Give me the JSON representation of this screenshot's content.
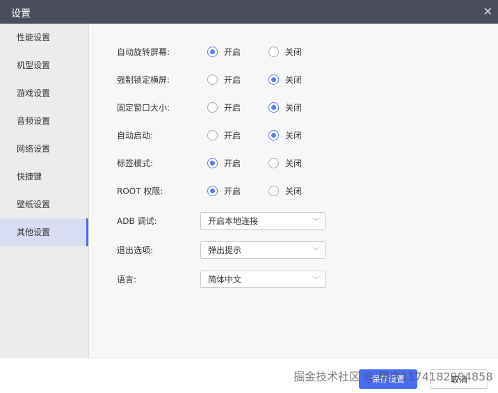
{
  "window": {
    "title": "设置",
    "close_icon": "close-icon"
  },
  "sidebar": {
    "items": [
      {
        "label": "性能设置"
      },
      {
        "label": "机型设置"
      },
      {
        "label": "游戏设置"
      },
      {
        "label": "音频设置"
      },
      {
        "label": "网络设置"
      },
      {
        "label": "快捷键"
      },
      {
        "label": "壁纸设置"
      },
      {
        "label": "其他设置",
        "active": true
      }
    ]
  },
  "radios": [
    {
      "label": "自动旋转屏幕:",
      "on": "开启",
      "off": "关闭",
      "selected": "on"
    },
    {
      "label": "强制锁定横屏:",
      "on": "开启",
      "off": "关闭",
      "selected": "off"
    },
    {
      "label": "固定窗口大小:",
      "on": "开启",
      "off": "关闭",
      "selected": "off"
    },
    {
      "label": "自动启动:",
      "on": "开启",
      "off": "关闭",
      "selected": "off"
    },
    {
      "label": "标签模式:",
      "on": "开启",
      "off": "关闭",
      "selected": "on"
    },
    {
      "label": "ROOT 权限:",
      "on": "开启",
      "off": "关闭",
      "selected": "on"
    }
  ],
  "selects": [
    {
      "label": "ADB 调试:",
      "value": "开启本地连接"
    },
    {
      "label": "退出选项:",
      "value": "弹出提示"
    },
    {
      "label": "语言:",
      "value": "简体中文"
    }
  ],
  "footer": {
    "save": "保存设置",
    "cancel": "取消"
  },
  "watermark": "掘金技术社区 @ 用户1174182904858",
  "colors": {
    "accent": "#4a6cf2",
    "titlebar": "#4a4e5c"
  }
}
